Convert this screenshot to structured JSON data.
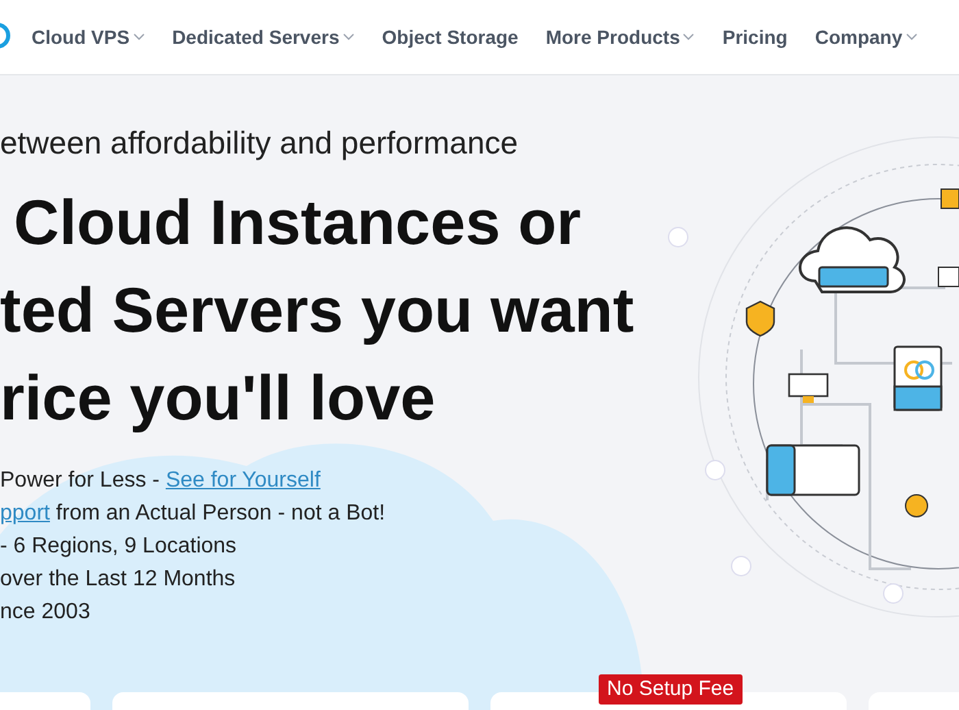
{
  "nav": {
    "items": [
      {
        "label": "Cloud VPS",
        "dropdown": true
      },
      {
        "label": "Dedicated Servers",
        "dropdown": true
      },
      {
        "label": "Object Storage",
        "dropdown": false
      },
      {
        "label": "More Products",
        "dropdown": true
      },
      {
        "label": "Pricing",
        "dropdown": false
      },
      {
        "label": "Company",
        "dropdown": true
      }
    ]
  },
  "hero": {
    "subtitle": "etween affordability and performance",
    "headline": [
      "Cloud Instances or",
      "ted Servers you want",
      "rice you'll love"
    ],
    "bullets": [
      [
        {
          "text": "Power for Less - ",
          "link": false
        },
        {
          "text": "See for Yourself",
          "link": true
        }
      ],
      [
        {
          "text": "pport",
          "link": true
        },
        {
          "text": " from an Actual Person - not a Bot!",
          "link": false
        }
      ],
      [
        {
          "text": "- 6 Regions, 9 Locations",
          "link": false
        }
      ],
      [
        {
          "text": "over the Last 12 Months",
          "link": false
        }
      ],
      [
        {
          "text": "nce 2003",
          "link": false
        }
      ]
    ]
  },
  "cards": [
    {
      "kind": "plain"
    },
    {
      "kind": "plain"
    },
    {
      "kind": "featured",
      "badge": "No Setup Fee"
    },
    {
      "kind": "plain"
    }
  ]
}
